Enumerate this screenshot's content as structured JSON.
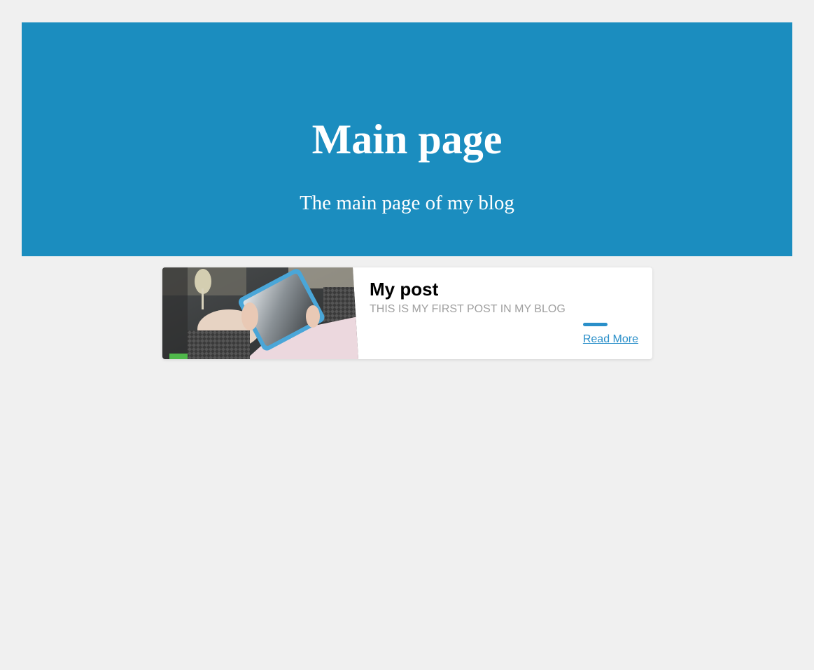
{
  "header": {
    "title": "Main page",
    "subtitle": "The main page of my blog"
  },
  "posts": [
    {
      "title": "My post",
      "description": "THIS IS MY FIRST POST IN MY BLOG",
      "read_more_label": "Read More",
      "image_icon": "tablet-photo"
    }
  ],
  "colors": {
    "header_bg": "#1b8dbf",
    "page_bg": "#f0f0f0",
    "accent": "#2a8fc9",
    "muted_text": "#a0a0a0"
  }
}
